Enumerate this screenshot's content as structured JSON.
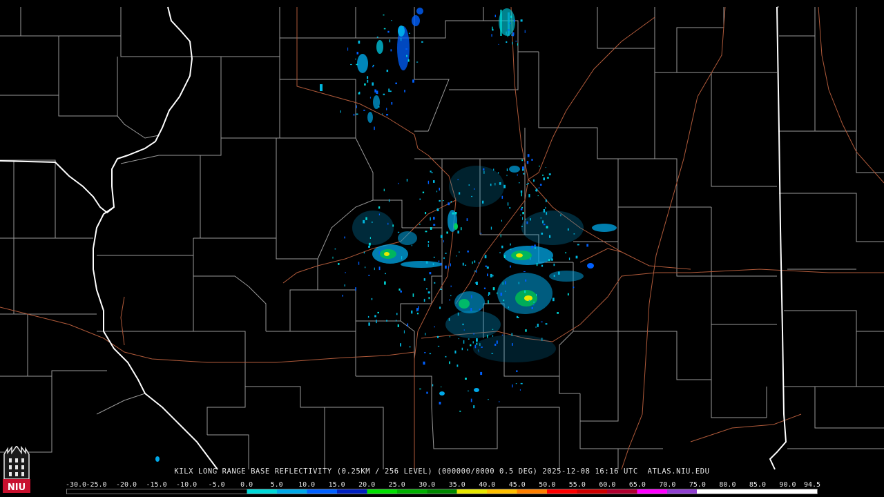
{
  "caption": {
    "text": "KILX LONG RANGE BASE REFLECTIVITY (0.25KM / 256 LEVEL) (000000/0000 0.5 DEG) 2025-12-08 16:16 UTC  ATLAS.NIU.EDU"
  },
  "color_scale": {
    "labels": [
      "-30.0",
      "-25.0",
      "-20.0",
      "-15.0",
      "-10.0",
      "-5.0",
      "0.0",
      "5.0",
      "10.0",
      "15.0",
      "20.0",
      "25.0",
      "30.0",
      "35.0",
      "40.0",
      "45.0",
      "50.0",
      "55.0",
      "60.0",
      "65.0",
      "70.0",
      "75.0",
      "80.0",
      "85.0",
      "90.0",
      "94.5"
    ],
    "colors": [
      "#000000",
      "#000000",
      "#000000",
      "#000000",
      "#000000",
      "#000000",
      "#00d8d8",
      "#00a8e8",
      "#0060ff",
      "#0020c0",
      "#00e000",
      "#00b000",
      "#008800",
      "#e8e800",
      "#ffc000",
      "#ff8000",
      "#ff0000",
      "#d00000",
      "#b00030",
      "#ff00ff",
      "#9040d0",
      "#ffffff",
      "#ffffff",
      "#ffffff",
      "#ffffff"
    ]
  },
  "logo": {
    "text": "NIU",
    "bg": "#c8102e"
  },
  "map": {
    "background": "#000000",
    "county_color": "#9a9a9a",
    "state_color": "#ffffff",
    "road_color": "#b05a3a"
  }
}
